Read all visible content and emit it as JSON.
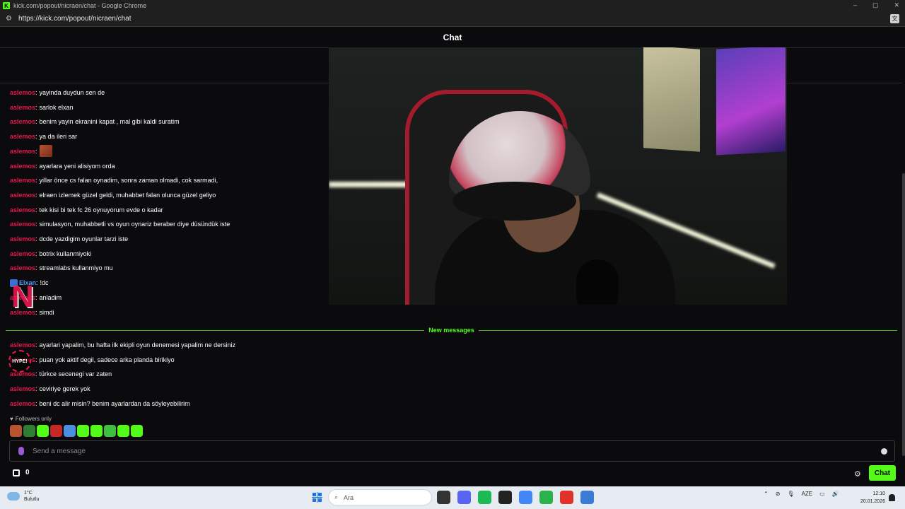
{
  "window": {
    "title": "kick.com/popout/nicraen/chat - Google Chrome",
    "url": "https://kick.com/popout/nicraen/chat",
    "favicon_letter": "K",
    "controls": [
      "–",
      "▢",
      "✕"
    ]
  },
  "chat": {
    "header_title": "Chat",
    "messages_before": [
      {
        "user": "aslemos",
        "text": "yayinda duydun sen de"
      },
      {
        "user": "aslemos",
        "text": "sarlok elxan"
      },
      {
        "user": "aslemos",
        "text": "benim yayin ekranini kapat , mal gibi kaldi suratim"
      },
      {
        "user": "aslemos",
        "text": "ya da ileri sar"
      },
      {
        "user": "aslemos",
        "text": "",
        "emote": true
      },
      {
        "user": "aslemos",
        "text": "ayarlara yeni alisiyom orda"
      },
      {
        "user": "aslemos",
        "text": "yillar önce cs falan oynadim, sonra zaman olmadi, cok sarmadi,"
      },
      {
        "user": "aslemos",
        "text": "elraen izlemek güzel geldi, muhabbet falan olunca güzel geliyo"
      },
      {
        "user": "aslemos",
        "text": "tek kisi bi tek fc 26 oynuyorum evde o kadar"
      },
      {
        "user": "aslemos",
        "text": "simulasyon, muhabbetli vs oyun oynariz beraber diye düsündük iste"
      },
      {
        "user": "aslemos",
        "text": "dcde yazdigim oyunlar tarzi iste"
      },
      {
        "user": "aslemos",
        "text": "botrix kullanmiyoki"
      },
      {
        "user": "aslemos",
        "text": "streamlabs kullanmiyo mu"
      },
      {
        "user": "Elxan",
        "text": "!dc",
        "blue": true
      },
      {
        "user": "aslemos",
        "text": "anladim"
      },
      {
        "user": "aslemos",
        "text": "simdi"
      }
    ],
    "new_messages_label": "New messages",
    "messages_after": [
      {
        "user": "aslemos",
        "text": "ayarlari yapalim, bu hafta ilk ekipli oyun denemesi yapalim ne dersiniz"
      },
      {
        "user": "aslemos",
        "text": "puan yok aktif degil, sadece arka planda birikiyo"
      },
      {
        "user": "aslemos",
        "text": "türkce secenegi var zaten"
      },
      {
        "user": "aslemos",
        "text": "ceviriye gerek yok"
      },
      {
        "user": "aslemos",
        "text": "beni dc alir misin? benim ayarlardan da söyleyebilirim"
      }
    ],
    "followers_only_label": "Followers only",
    "input_placeholder": "Send a message",
    "points_value": "0",
    "chat_button_label": "Chat",
    "overlay_hype_label": "HYPE!",
    "emote_colors": [
      "#b85430",
      "#2f7d32",
      "#53fc18",
      "#c62828",
      "#4a8fe0",
      "#53fc18",
      "#53fc18",
      "#3fbf3f",
      "#53fc18",
      "#53fc18"
    ]
  },
  "taskbar": {
    "weather_temp": "1°C",
    "weather_desc": "Bulutlu",
    "search_placeholder": "Ara",
    "language": "AZE",
    "time": "12:10",
    "date": "20.01.2026",
    "app_colors": [
      "#333333",
      "#5865f2",
      "#1db954",
      "#222222",
      "#4285f4",
      "#2bb24c",
      "#e0312a",
      "#3a7bd5"
    ]
  },
  "colors": {
    "accent": "#53fc18",
    "username": "#e8174d",
    "username_alt": "#4a9cff",
    "background": "#0b0b0d"
  }
}
